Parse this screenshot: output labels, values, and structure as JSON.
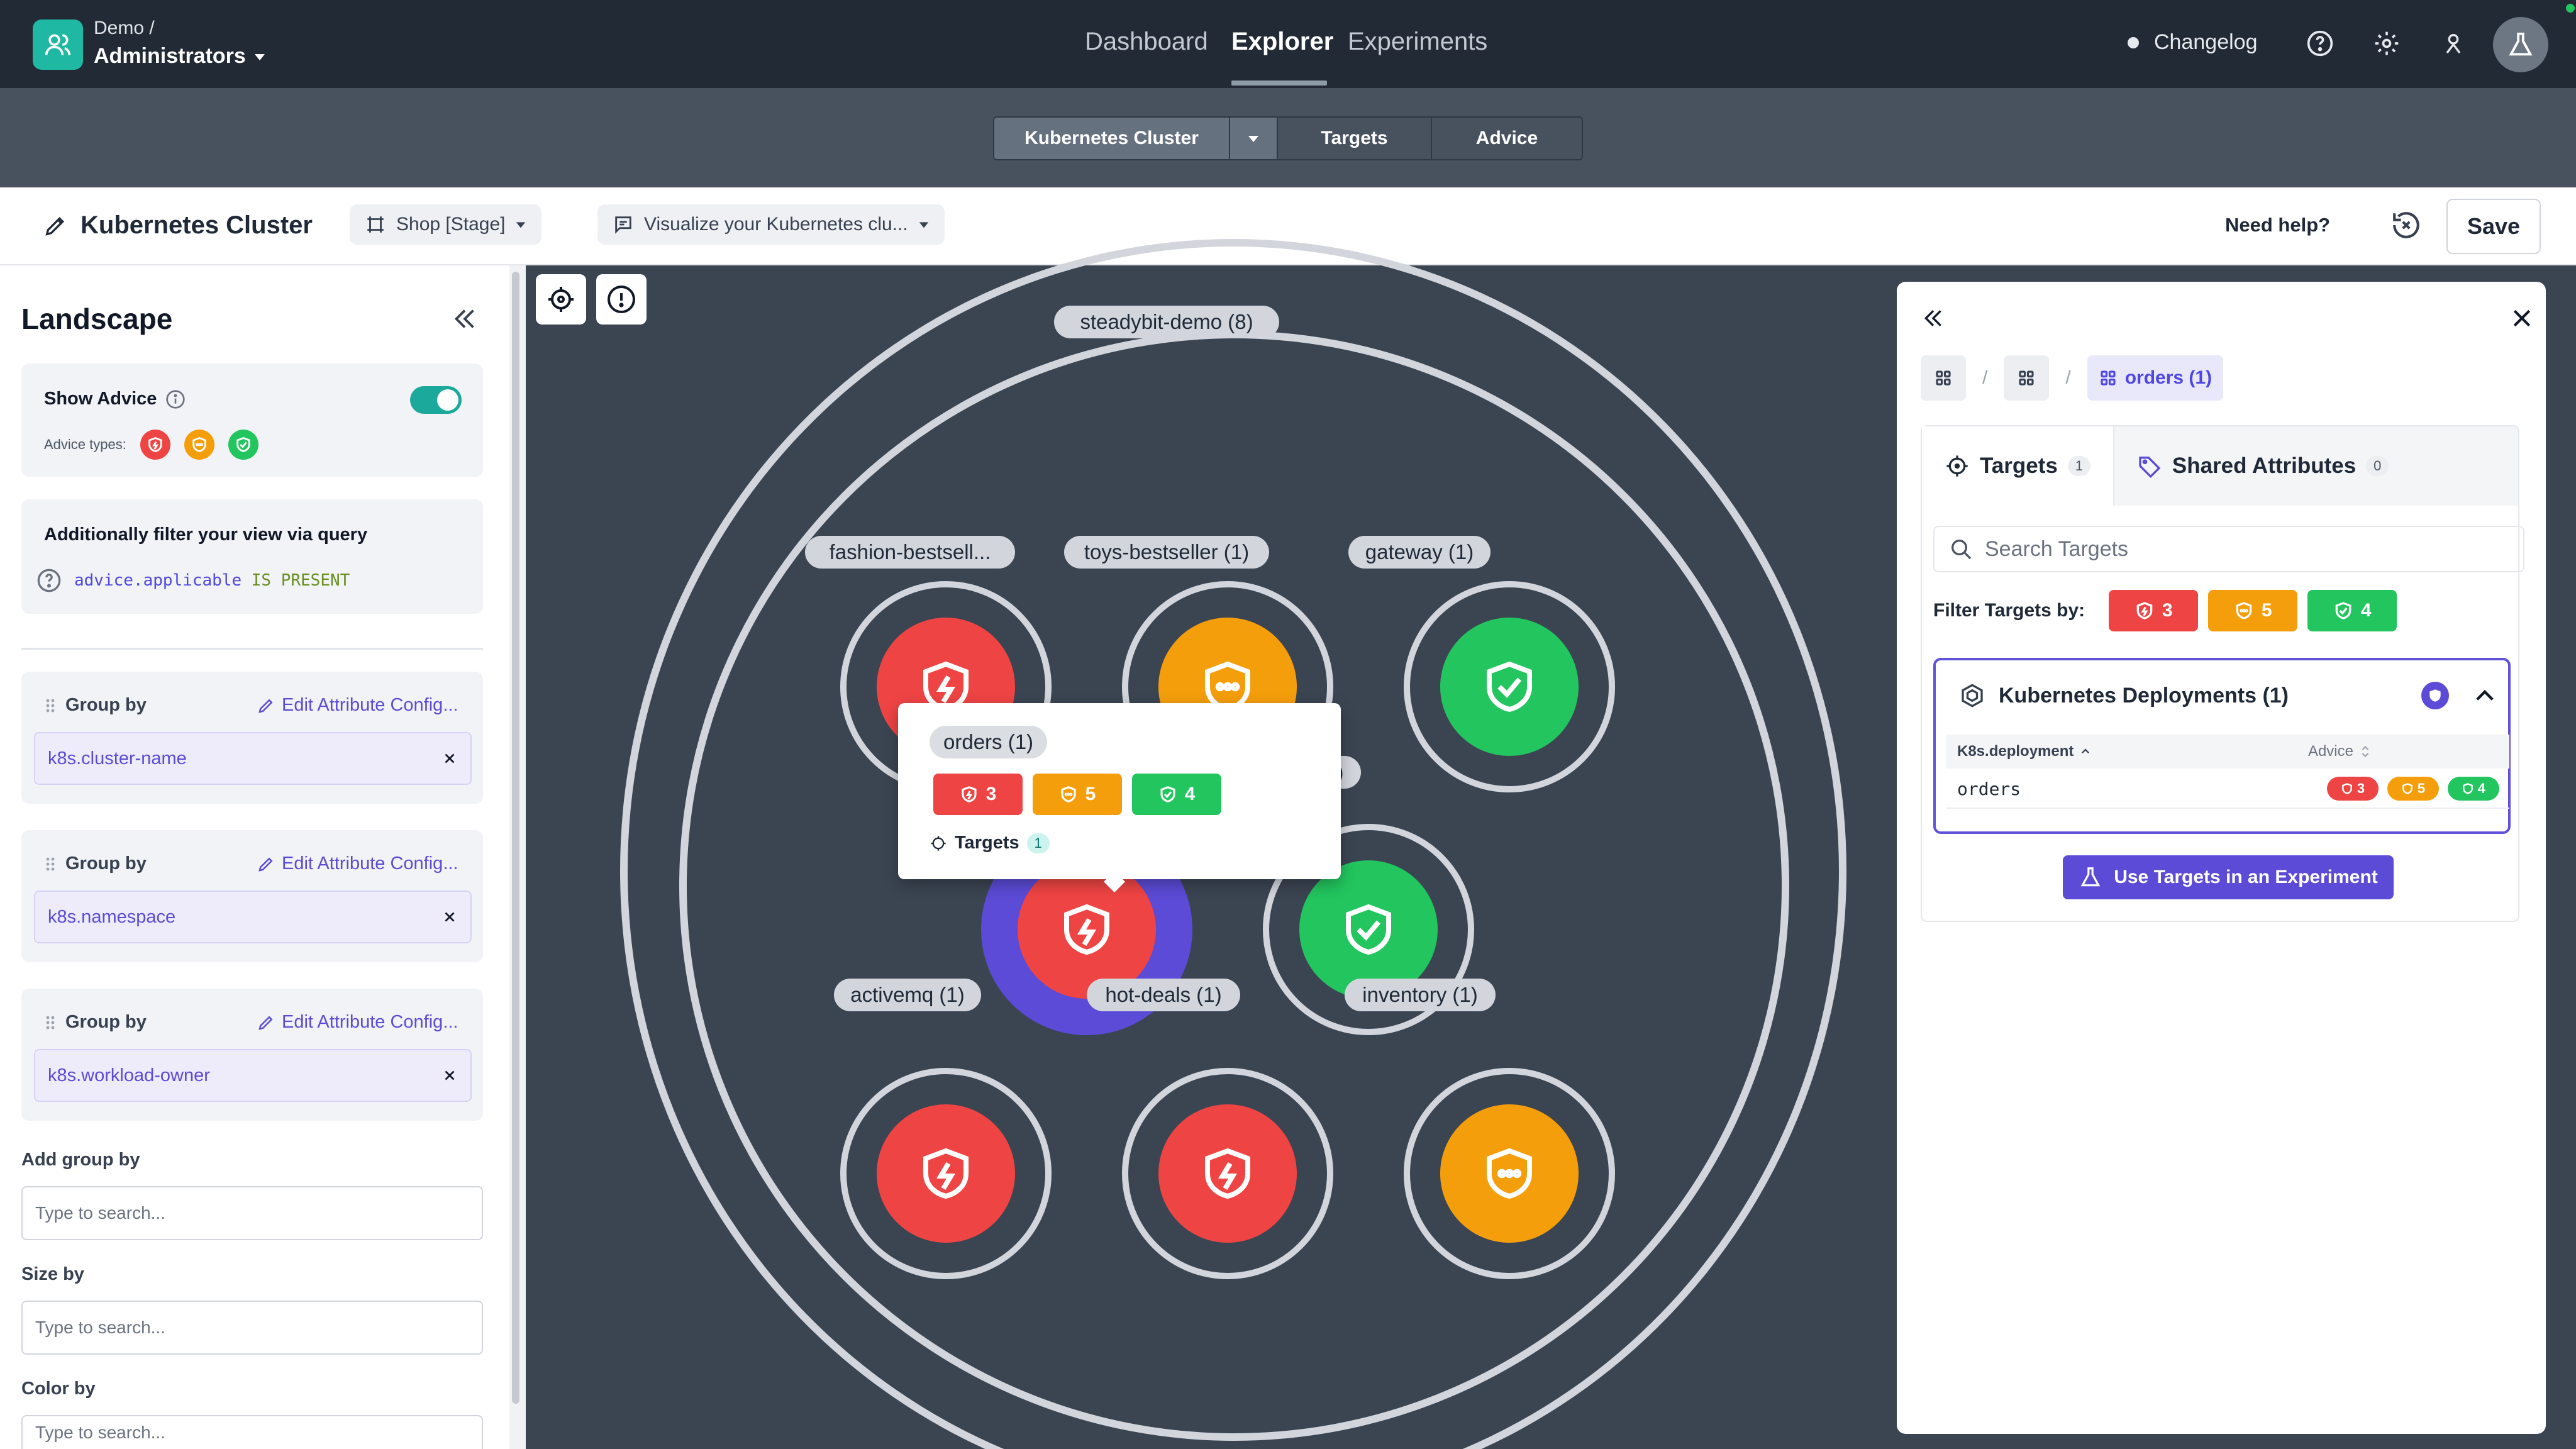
{
  "app": {
    "org_path": "Demo /",
    "org_name": "Administrators",
    "nav": [
      "Dashboard",
      "Explorer",
      "Experiments"
    ],
    "changelog": "Changelog"
  },
  "subnav": {
    "tabs": [
      "Kubernetes Cluster",
      "Targets",
      "Advice"
    ]
  },
  "toolbar": {
    "title": "Kubernetes Cluster",
    "environment": "Shop [Stage]",
    "description": "Visualize your Kubernetes clu...",
    "need_help": "Need help?",
    "save": "Save"
  },
  "sidebar": {
    "heading": "Landscape",
    "show_advice": "Show Advice",
    "advice_types_label": "Advice types:",
    "query_title": "Additionally filter your view via query",
    "query_attr": "advice.applicable",
    "query_op": "IS PRESENT",
    "group_label": "Group by",
    "edit_config": "Edit Attribute Config...",
    "groups": [
      "k8s.cluster-name",
      "k8s.namespace",
      "k8s.workload-owner"
    ],
    "add_group_by": "Add group by",
    "size_by": "Size by",
    "color_by": "Color by",
    "search_placeholder": "Type to search..."
  },
  "canvas": {
    "outer_label": "steadybit-demo (8)",
    "labels": [
      "fashion-bestsell...",
      "toys-bestseller (1)",
      "gateway (1)",
      "activemq (1)",
      "hot-deals (1)",
      "inventory (1)",
      ")"
    ]
  },
  "tooltip": {
    "name": "orders (1)",
    "red": "3",
    "orange": "5",
    "green": "4",
    "targets_label": "Targets",
    "targets_count": "1"
  },
  "panel": {
    "crumb": "orders (1)",
    "tab_targets": "Targets",
    "tab_targets_count": "1",
    "tab_shared": "Shared Attributes",
    "tab_shared_count": "0",
    "search_placeholder": "Search Targets",
    "filter_label": "Filter Targets by:",
    "filter_red": "3",
    "filter_orange": "5",
    "filter_green": "4",
    "deploy_title": "Kubernetes Deployments (1)",
    "col_deployment": "K8s.deployment",
    "col_advice": "Advice",
    "row_name": "orders",
    "row_red": "3",
    "row_orange": "5",
    "row_green": "4",
    "use_targets": "Use Targets in an Experiment"
  },
  "colors": {
    "red": "#ef4444",
    "orange": "#f59e0b",
    "green": "#22c55e",
    "accent": "#5b4bd6",
    "teal": "#1fb8a3"
  }
}
